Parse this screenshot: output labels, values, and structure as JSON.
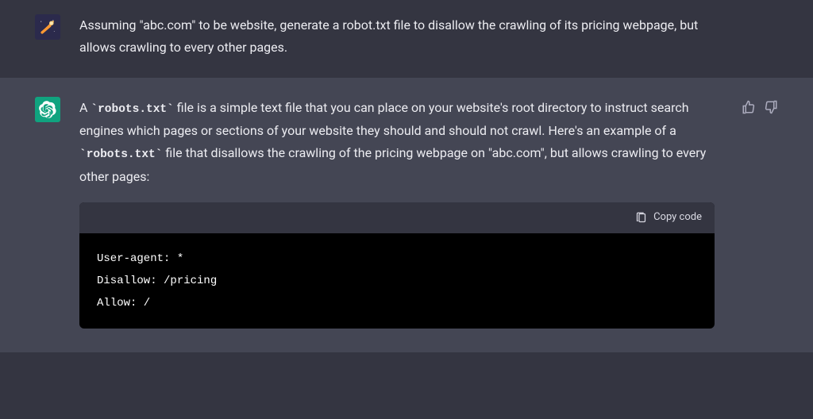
{
  "user": {
    "message": "Assuming \"abc.com\" to be website, generate a robot.txt file to disallow the crawling of its pricing webpage, but allows crawling to every other pages."
  },
  "assistant": {
    "text_parts": {
      "p1": "A ",
      "code1": "`robots.txt`",
      "p2": " file is a simple text file that you can place on your website's root directory to instruct search engines which pages or sections of your website they should and should not crawl. Here's an example of a ",
      "code2": "`robots.txt`",
      "p3": " file that disallows the crawling of the pricing webpage on \"abc.com\", but allows crawling to every other pages:"
    },
    "code_block": {
      "copy_label": "Copy code",
      "content": "User-agent: *\nDisallow: /pricing\nAllow: /"
    }
  },
  "icons": {
    "user_avatar": "comet-icon",
    "assistant_avatar": "openai-icon",
    "thumbs_up": "thumbs-up-icon",
    "thumbs_down": "thumbs-down-icon",
    "clipboard": "clipboard-icon"
  }
}
